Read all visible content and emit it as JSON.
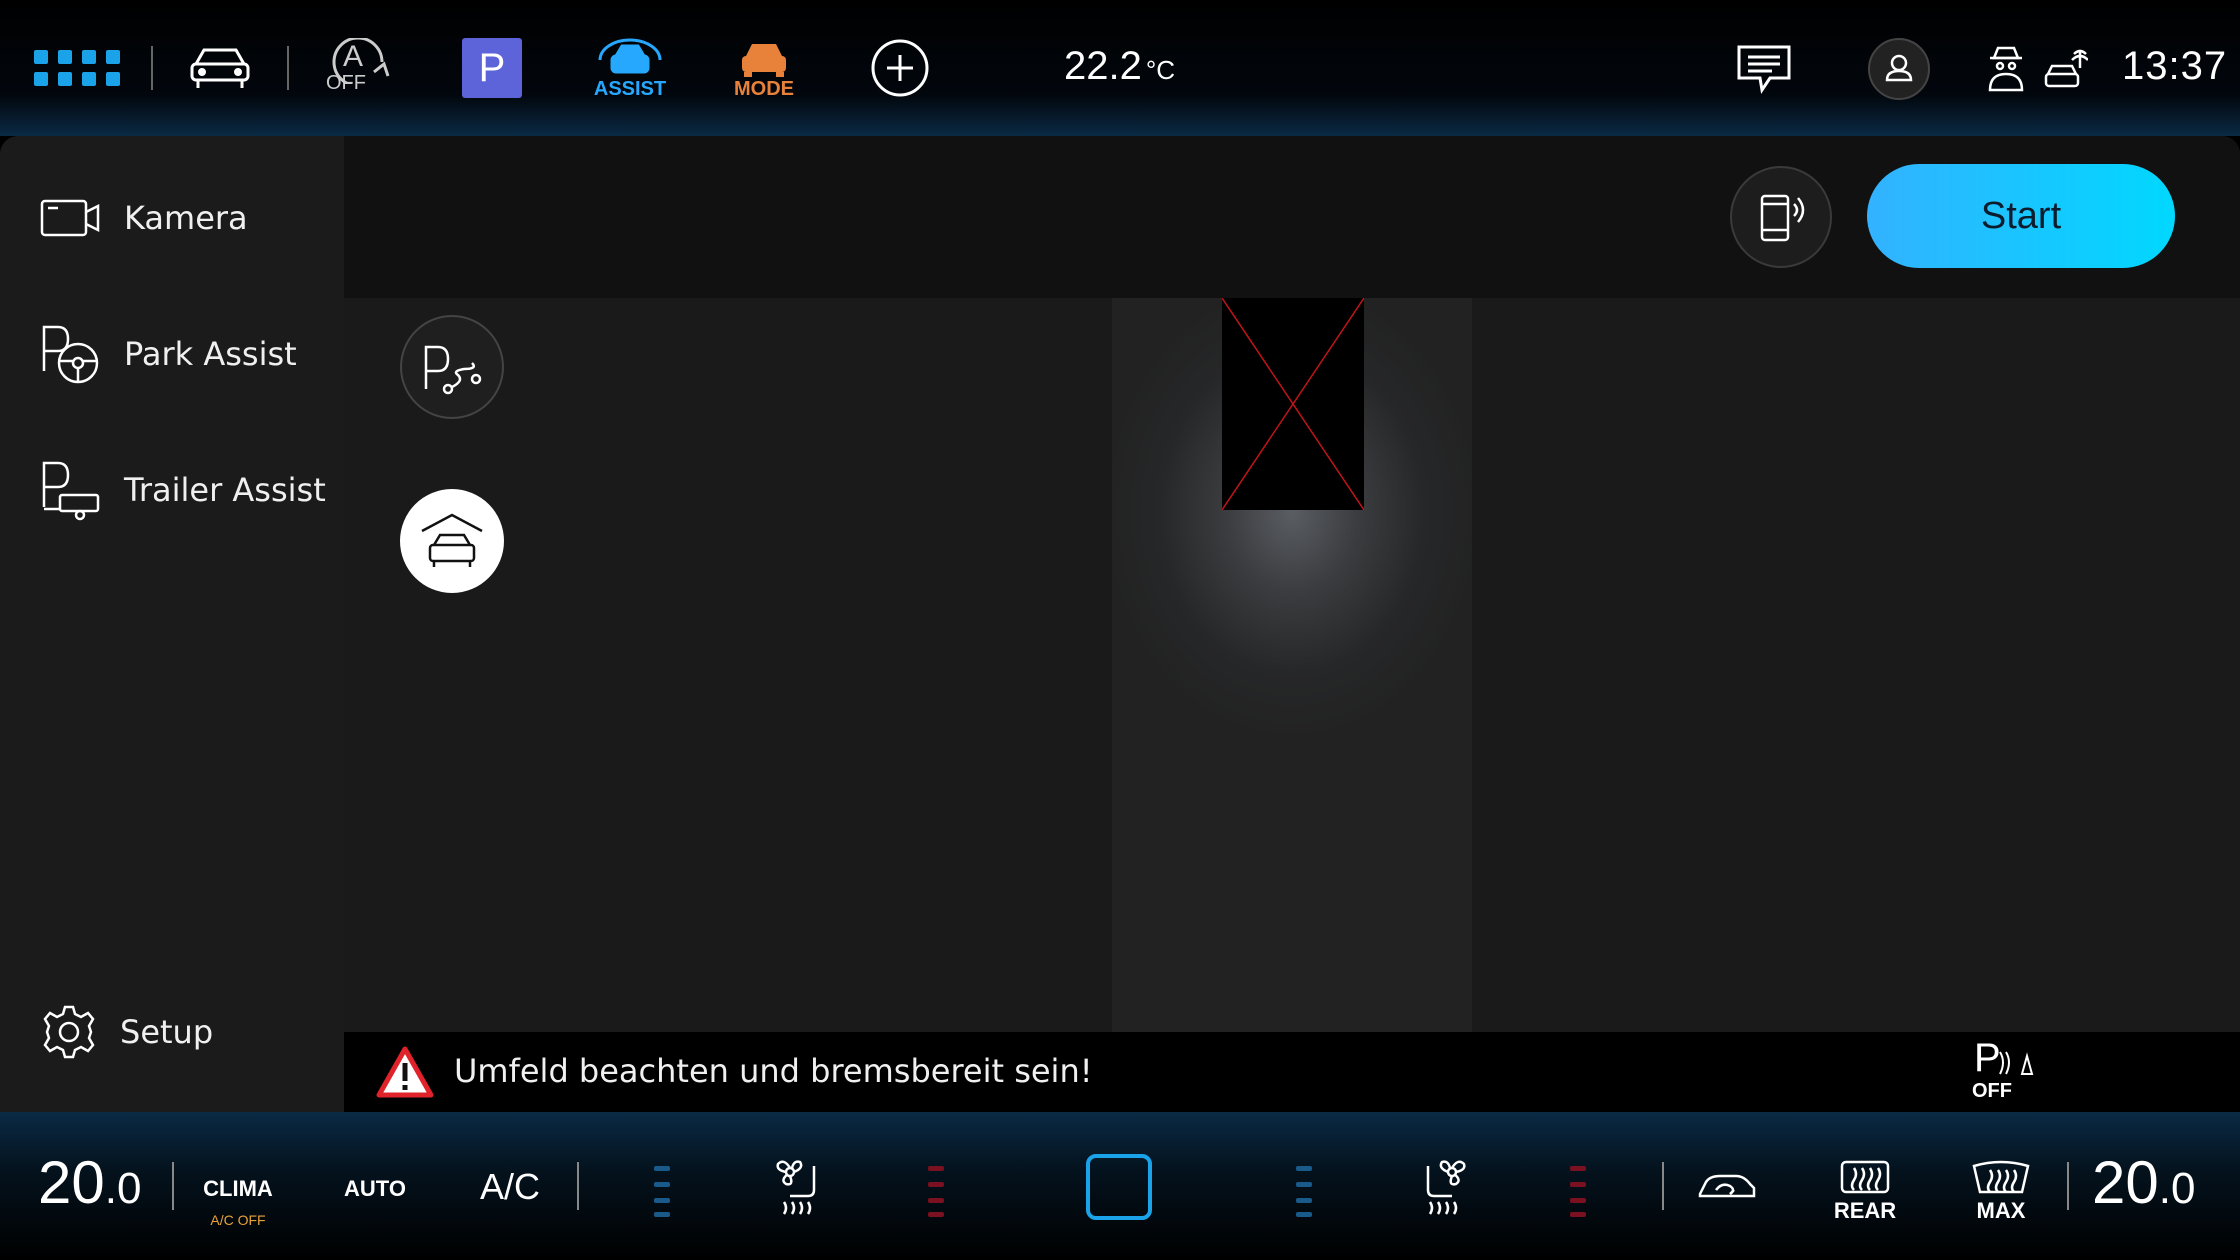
{
  "colors": {
    "accent": "#1aa3e8",
    "assist_blue": "#27a8ff",
    "mode_orange": "#e8823a",
    "start_gradient_left": "#33b2ff",
    "start_gradient_right": "#00d8ff",
    "parking_purple": "#5d63d8",
    "warning_red": "#e0222a",
    "fan_blue": "#1a5a8a",
    "fan_red": "#7a1020"
  },
  "topbar": {
    "apps_icon": "grid-icon",
    "auto_hold": {
      "letter": "A",
      "label": "OFF"
    },
    "parking_letter": "P",
    "assist_label": "ASSIST",
    "mode_label": "MODE",
    "outside_temp": "22.2",
    "temp_unit": "°C",
    "time": "13:37"
  },
  "sidebar": {
    "items": [
      {
        "label": "Kamera",
        "icon": "camera-icon"
      },
      {
        "label": "Park Assist",
        "icon": "park-assist-icon"
      },
      {
        "label": "Trailer Assist",
        "icon": "trailer-assist-icon"
      }
    ],
    "setup_label": "Setup"
  },
  "main": {
    "start_label": "Start",
    "warning_text": "Umfeld beachten und bremsbereit sein!",
    "park_sensor": {
      "letter": "P",
      "label": "OFF"
    }
  },
  "climate": {
    "left_temp_int": "20",
    "left_temp_dec": ".0",
    "clima_label": "CLIMA",
    "ac_status": "A/C OFF",
    "auto_label": "AUTO",
    "ac_label": "A/C",
    "rear_label": "REAR",
    "max_label": "MAX",
    "right_temp_int": "20",
    "right_temp_dec": ".0"
  }
}
